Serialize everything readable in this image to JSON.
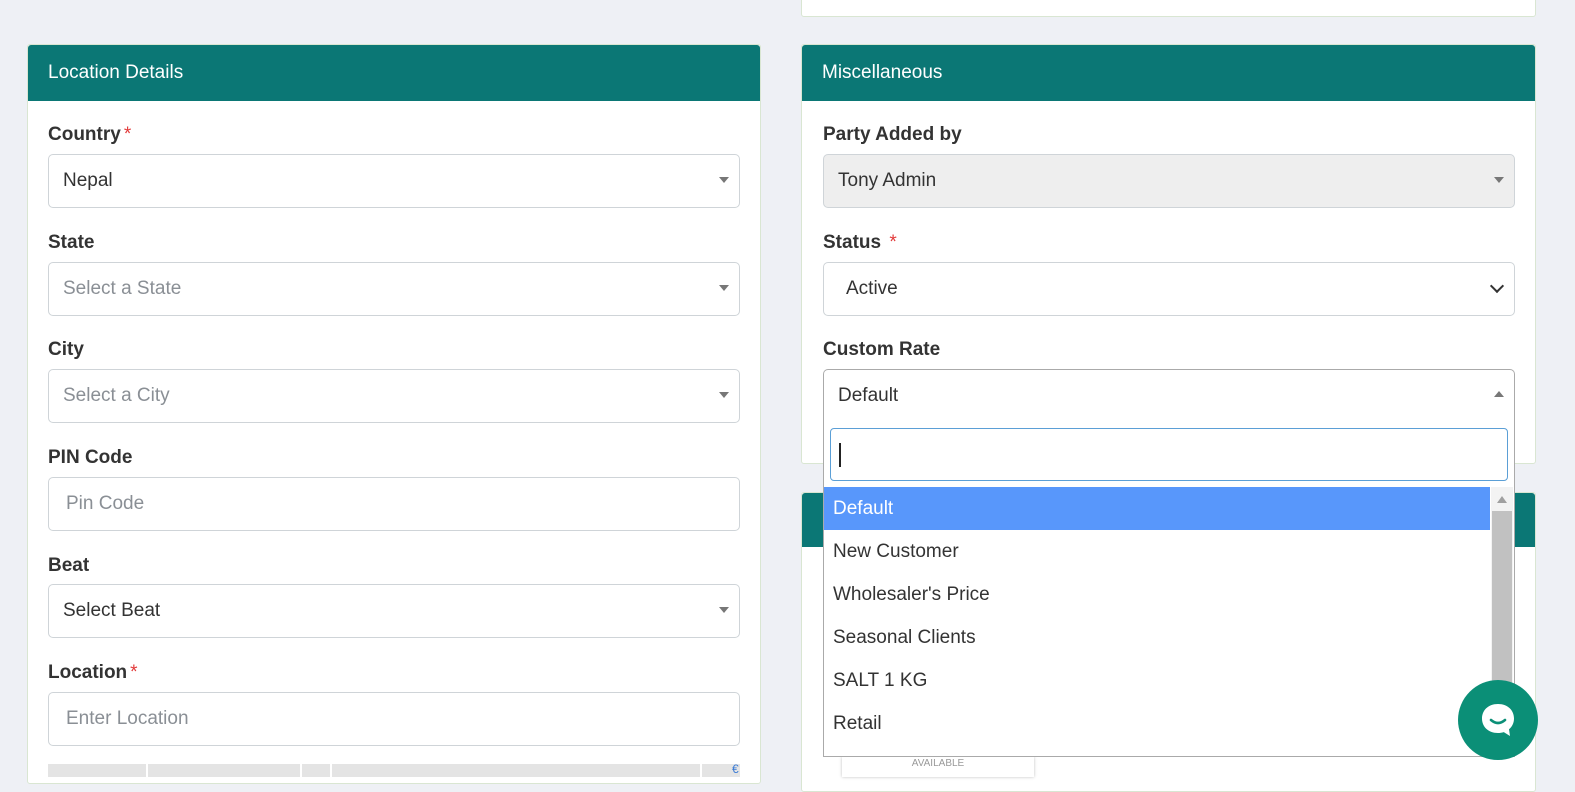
{
  "location": {
    "title": "Location Details",
    "country": {
      "label": "Country",
      "value": "Nepal"
    },
    "state": {
      "label": "State",
      "placeholder": "Select a State"
    },
    "city": {
      "label": "City",
      "placeholder": "Select a City"
    },
    "pin": {
      "label": "PIN Code",
      "placeholder": "Pin Code"
    },
    "beat": {
      "label": "Beat",
      "value": "Select Beat"
    },
    "loc": {
      "label": "Location",
      "placeholder": "Enter Location"
    }
  },
  "misc": {
    "title": "Miscellaneous",
    "added_by": {
      "label": "Party Added by",
      "value": "Tony Admin"
    },
    "status": {
      "label": "Status",
      "value": "Active"
    },
    "custom_rate": {
      "label": "Custom Rate",
      "value": "Default"
    }
  },
  "required_mark": "*",
  "dropdown": {
    "search_value": "",
    "options": [
      "Default",
      "New Customer",
      "Wholesaler's Price",
      "Seasonal Clients",
      "SALT 1 KG",
      "Retail"
    ],
    "highlighted": "Default"
  },
  "map_overlay": {
    "available_text": "AVAILABLE",
    "glyph": "€"
  },
  "colors": {
    "header": "#0b7775",
    "highlight": "#5897fb",
    "required": "#e23a3a",
    "chat": "#0b8f77"
  },
  "icons": {
    "chat": "chat-bubble-icon",
    "caret": "caret-down-icon",
    "chevron": "chevron-down-icon"
  }
}
